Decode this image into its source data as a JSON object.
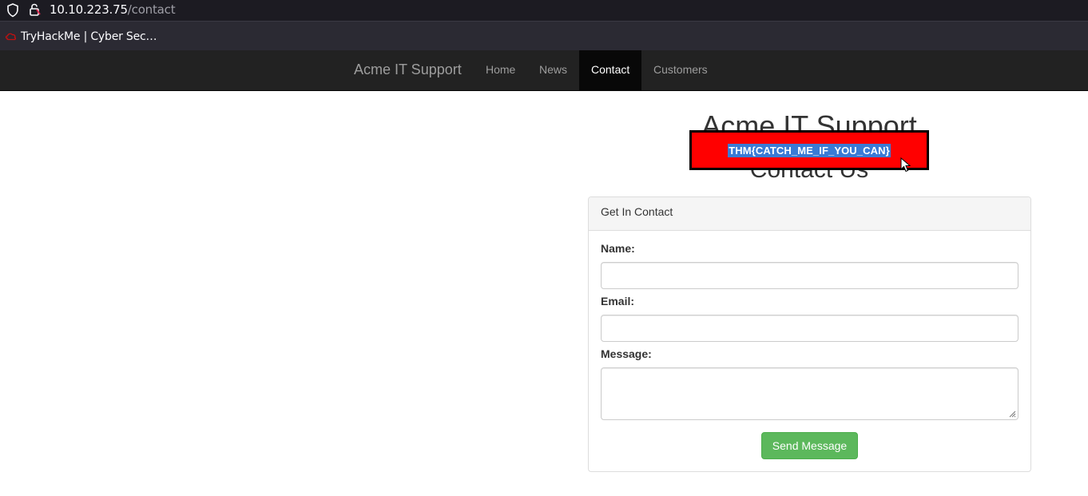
{
  "browser": {
    "url_host": "10.10.223.75",
    "url_path": "/contact",
    "icons": [
      "shield-icon",
      "lock-icon"
    ],
    "bookmark": {
      "label": "TryHackMe | Cyber Sec…",
      "icon": "tryhackme-icon"
    }
  },
  "navbar": {
    "brand": "Acme IT Support",
    "items": [
      {
        "label": "Home",
        "active": false
      },
      {
        "label": "News",
        "active": false
      },
      {
        "label": "Contact",
        "active": true
      },
      {
        "label": "Customers",
        "active": false
      }
    ]
  },
  "page": {
    "title": "Acme IT Support",
    "subtitle": "Contact Us",
    "flag_popup": {
      "text": "THM{CATCH_ME_IF_YOU_CAN}",
      "selected": true
    }
  },
  "form": {
    "panel_heading": "Get In Contact",
    "name_label": "Name:",
    "name_value": "",
    "email_label": "Email:",
    "email_value": "",
    "message_label": "Message:",
    "message_value": "",
    "submit_label": "Send Message"
  },
  "colors": {
    "navbar_bg": "#222222",
    "nav_active_bg": "#080808",
    "flag_bg": "#ff0000",
    "selection": "#3a7bd5",
    "button_success": "#5cb85c"
  }
}
